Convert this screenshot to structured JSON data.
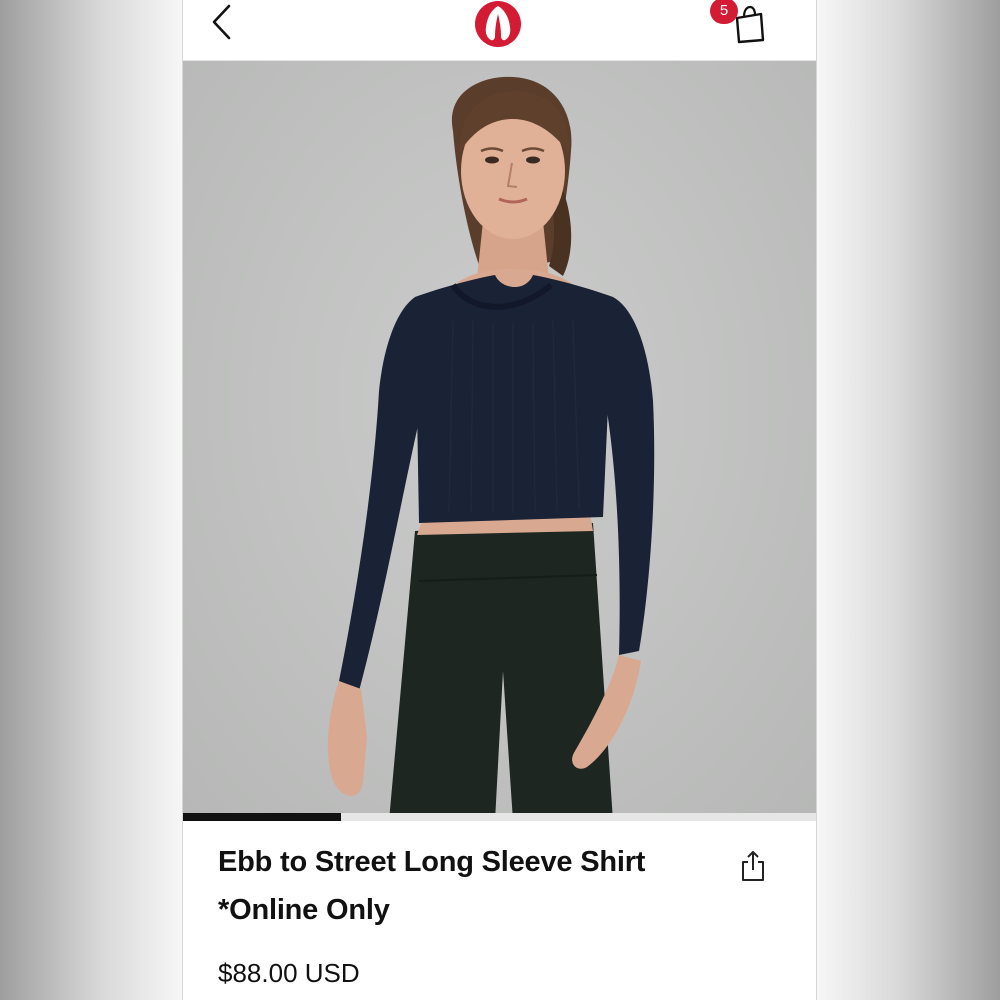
{
  "header": {
    "brand_icon": "lululemon-logo-icon",
    "back_icon": "chevron-left-icon",
    "bag_icon": "shopping-bag-icon",
    "bag_count": "5"
  },
  "product": {
    "title_line1": "Ebb to Street Long Sleeve Shirt",
    "title_line2": "*Online Only",
    "price": "$88.00 USD",
    "share_icon": "share-icon"
  },
  "carousel": {
    "progress": 0.25
  },
  "colors": {
    "brand_red": "#d31b34",
    "text": "#111111",
    "shirt_navy": "#1a2236",
    "leggings_green": "#1d2620"
  }
}
